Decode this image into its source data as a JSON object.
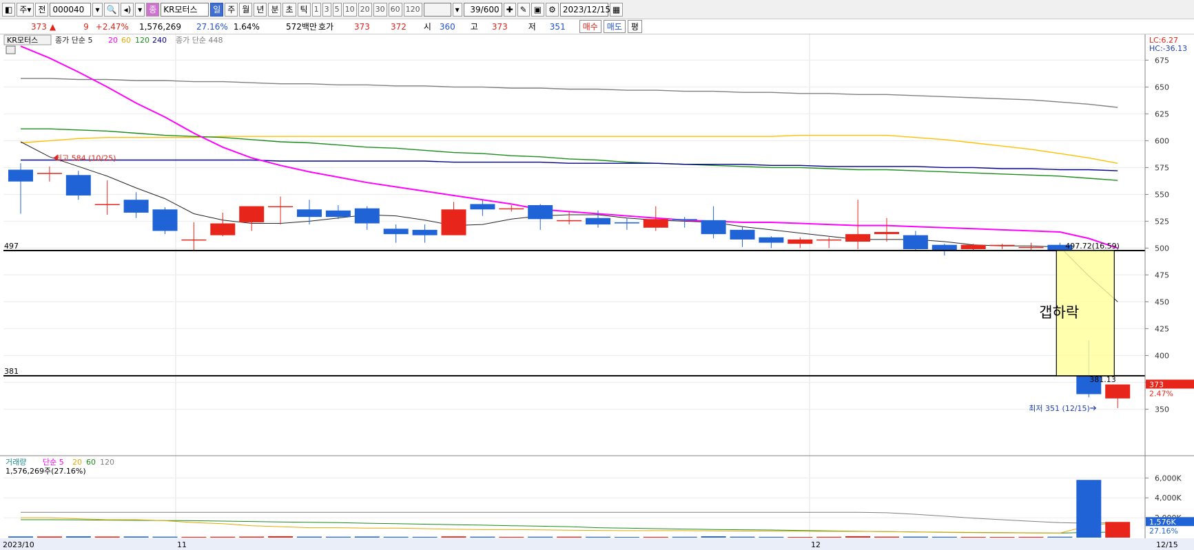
{
  "toolbar": {
    "type_label": "주",
    "prev_label": "전",
    "code": "000040",
    "stock_name": "KR모터스",
    "periods": [
      "일",
      "주",
      "월",
      "년",
      "분",
      "초",
      "틱"
    ],
    "selected_period": "일",
    "intervals": [
      "1",
      "3",
      "5",
      "10",
      "20",
      "30",
      "60",
      "120"
    ],
    "count": "39",
    "count_total": "/600",
    "date": "2023/12/15"
  },
  "quote": {
    "price": "373",
    "arrow": "▲",
    "change": "9",
    "change_pct": "+2.47%",
    "volume": "1,576,269",
    "volume_pct": "27.16%",
    "turnover_pct": "1.64%",
    "amount": "572백만",
    "hoga_label": "호가",
    "ask": "373",
    "bid": "372",
    "open_label": "시",
    "open": "360",
    "high_label": "고",
    "high": "373",
    "low_label": "저",
    "low": "351",
    "buy_label": "매수",
    "sell_label": "매도",
    "eval_label": "평"
  },
  "price_panel": {
    "legend": {
      "name": "KR모터스",
      "ma_label": "종가 단순 5",
      "ma20": "20",
      "ma60": "60",
      "ma120": "120",
      "ma240": "240",
      "ma448": "종가 단순 448"
    },
    "lc": "LC:6.27",
    "hc": "HC:-36.13",
    "max_label": "최고 584 (10/25)",
    "min_label": "최저 351 (12/15)",
    "level_497_text": "497",
    "level_381_text": "381",
    "box_top_text": "497.72(16.59)",
    "box_bottom_text": "381.13",
    "gap_text": "갭하락",
    "last_price_tag": "373",
    "last_change_tag": "2.47%",
    "y_ticks": [
      "675",
      "650",
      "625",
      "600",
      "575",
      "550",
      "525",
      "500",
      "475",
      "450",
      "425",
      "400",
      "375",
      "350"
    ]
  },
  "volume_panel": {
    "legend": {
      "name": "거래량",
      "ma_label": "단순 5",
      "ma20": "20",
      "ma60": "60",
      "ma120": "120"
    },
    "info": "1,576,269주(27.16%)",
    "y_ticks": [
      "6,000K",
      "4,000K",
      "2,000K"
    ],
    "last_vol_tag": "1,576K",
    "last_pct_tag": "27.16%"
  },
  "x_axis": {
    "labels": [
      "2023/10",
      "11",
      "12",
      "12/15"
    ]
  },
  "colors": {
    "up": "#e8251a",
    "down": "#1f63d6",
    "ma5": "#222222",
    "ma20": "#ff00ff",
    "ma60": "#ffbf00",
    "ma120": "#1a8c1a",
    "ma240": "#00008b",
    "ma448": "#7f7f7f"
  },
  "chart_data": {
    "type": "candlestick",
    "candles": [
      {
        "o": 573,
        "h": 579,
        "l": 532,
        "c": 562
      },
      {
        "o": 570,
        "h": 576,
        "l": 562,
        "c": 570
      },
      {
        "o": 568,
        "h": 572,
        "l": 545,
        "c": 549
      },
      {
        "o": 541,
        "h": 563,
        "l": 531,
        "c": 541
      },
      {
        "o": 545,
        "h": 552,
        "l": 528,
        "c": 533
      },
      {
        "o": 536,
        "h": 538,
        "l": 513,
        "c": 516
      },
      {
        "o": 508,
        "h": 524,
        "l": 498,
        "c": 508
      },
      {
        "o": 512,
        "h": 533,
        "l": 511,
        "c": 523
      },
      {
        "o": 524,
        "h": 539,
        "l": 516,
        "c": 539
      },
      {
        "o": 539,
        "h": 548,
        "l": 522,
        "c": 539
      },
      {
        "o": 536,
        "h": 545,
        "l": 522,
        "c": 529
      },
      {
        "o": 535,
        "h": 540,
        "l": 527,
        "c": 529
      },
      {
        "o": 537,
        "h": 539,
        "l": 517,
        "c": 523
      },
      {
        "o": 518,
        "h": 522,
        "l": 505,
        "c": 513
      },
      {
        "o": 517,
        "h": 522,
        "l": 505,
        "c": 512
      },
      {
        "o": 512,
        "h": 543,
        "l": 512,
        "c": 536
      },
      {
        "o": 541,
        "h": 545,
        "l": 530,
        "c": 536
      },
      {
        "o": 537,
        "h": 540,
        "l": 534,
        "c": 537
      },
      {
        "o": 540,
        "h": 541,
        "l": 517,
        "c": 527
      },
      {
        "o": 526,
        "h": 534,
        "l": 522,
        "c": 526
      },
      {
        "o": 528,
        "h": 535,
        "l": 519,
        "c": 522
      },
      {
        "o": 524,
        "h": 528,
        "l": 517,
        "c": 523
      },
      {
        "o": 519,
        "h": 539,
        "l": 516,
        "c": 527
      },
      {
        "o": 527,
        "h": 529,
        "l": 519,
        "c": 526
      },
      {
        "o": 526,
        "h": 539,
        "l": 509,
        "c": 513
      },
      {
        "o": 517,
        "h": 520,
        "l": 501,
        "c": 508
      },
      {
        "o": 510,
        "h": 511,
        "l": 500,
        "c": 505
      },
      {
        "o": 504,
        "h": 510,
        "l": 500,
        "c": 508
      },
      {
        "o": 508,
        "h": 510,
        "l": 500,
        "c": 508
      },
      {
        "o": 506,
        "h": 545,
        "l": 499,
        "c": 513
      },
      {
        "o": 513,
        "h": 528,
        "l": 506,
        "c": 515
      },
      {
        "o": 512,
        "h": 516,
        "l": 498,
        "c": 499
      },
      {
        "o": 503,
        "h": 504,
        "l": 493,
        "c": 498
      },
      {
        "o": 499,
        "h": 504,
        "l": 498,
        "c": 503
      },
      {
        "o": 502,
        "h": 504,
        "l": 499,
        "c": 503
      },
      {
        "o": 501,
        "h": 505,
        "l": 498,
        "c": 501
      },
      {
        "o": 503,
        "h": 505,
        "l": 497,
        "c": 497
      },
      {
        "o": 381,
        "h": 414,
        "l": 361,
        "c": 364
      },
      {
        "o": 360,
        "h": 373,
        "l": 351,
        "c": 373
      }
    ],
    "ma5": [
      599,
      585,
      576,
      567,
      556,
      546,
      532,
      526,
      523,
      523,
      525,
      528,
      531,
      530,
      526,
      521,
      522,
      527,
      530,
      531,
      531,
      528,
      526,
      525,
      524,
      520,
      517,
      514,
      511,
      508,
      508,
      508,
      506,
      503,
      502,
      502,
      501,
      474,
      450
    ],
    "ma20": [
      688,
      677,
      664,
      650,
      635,
      622,
      607,
      594,
      584,
      577,
      571,
      566,
      561,
      557,
      553,
      549,
      545,
      541,
      536,
      534,
      532,
      530,
      528,
      526,
      525,
      524,
      524,
      523,
      522,
      521,
      521,
      520,
      519,
      518,
      517,
      516,
      515,
      509,
      500
    ],
    "ma60": [
      598,
      600,
      602,
      603,
      603,
      603,
      603,
      604,
      604,
      604,
      604,
      604,
      604,
      604,
      604,
      604,
      604,
      604,
      604,
      604,
      604,
      604,
      604,
      604,
      604,
      604,
      604,
      605,
      605,
      605,
      605,
      603,
      601,
      598,
      595,
      592,
      588,
      584,
      579
    ],
    "ma120": [
      611,
      611,
      610,
      609,
      607,
      605,
      604,
      603,
      601,
      599,
      598,
      596,
      594,
      593,
      591,
      589,
      588,
      586,
      585,
      583,
      582,
      580,
      579,
      578,
      577,
      576,
      575,
      575,
      574,
      573,
      573,
      572,
      571,
      570,
      569,
      568,
      567,
      565,
      563
    ],
    "ma240": [
      582,
      582,
      582,
      582,
      582,
      582,
      582,
      582,
      582,
      581,
      581,
      581,
      581,
      581,
      581,
      580,
      580,
      580,
      580,
      579,
      579,
      579,
      579,
      578,
      578,
      578,
      577,
      577,
      576,
      576,
      576,
      576,
      575,
      575,
      574,
      574,
      573,
      573,
      572
    ],
    "ma448": [
      658,
      658,
      657,
      657,
      656,
      656,
      655,
      655,
      654,
      653,
      653,
      652,
      652,
      651,
      651,
      650,
      650,
      649,
      649,
      648,
      648,
      647,
      647,
      646,
      646,
      645,
      645,
      644,
      644,
      643,
      643,
      642,
      641,
      640,
      639,
      638,
      636,
      634,
      631
    ],
    "volume": [
      120,
      115,
      130,
      110,
      112,
      95,
      80,
      90,
      105,
      140,
      100,
      90,
      110,
      85,
      80,
      125,
      95,
      80,
      90,
      95,
      85,
      70,
      80,
      85,
      135,
      95,
      80,
      70,
      85,
      140,
      100,
      100,
      85,
      75,
      70,
      80,
      90,
      5800,
      1576
    ],
    "vol_ma5": [
      2000,
      2000,
      1900,
      1800,
      1800,
      1700,
      1500,
      1400,
      1200,
      1100,
      1000,
      1000,
      950,
      950,
      900,
      850,
      800,
      800,
      780,
      750,
      720,
      700,
      700,
      700,
      680,
      660,
      650,
      640,
      630,
      620,
      600,
      560,
      520,
      500,
      480,
      470,
      460,
      1200,
      1500
    ],
    "vol_ma20": [
      1800,
      1800,
      1780,
      1760,
      1740,
      1720,
      1700,
      1660,
      1620,
      1580,
      1540,
      1500,
      1450,
      1400,
      1350,
      1300,
      1250,
      1200,
      1150,
      1100,
      1000,
      950,
      900,
      860,
      820,
      790,
      760,
      720,
      680,
      640,
      600,
      570,
      540,
      520,
      500,
      480,
      460,
      520,
      560
    ],
    "vol_ma120": [
      2550,
      2550,
      2550,
      2550,
      2550,
      2550,
      2550,
      2550,
      2550,
      2550,
      2550,
      2550,
      2550,
      2550,
      2550,
      2550,
      2550,
      2550,
      2550,
      2550,
      2550,
      2550,
      2550,
      2550,
      2550,
      2550,
      2550,
      2550,
      2550,
      2550,
      2500,
      2350,
      2150,
      1950,
      1800,
      1650,
      1500,
      1450,
      1500
    ],
    "price_ylim": [
      340,
      690
    ],
    "volume_ylim": [
      0,
      6300
    ]
  }
}
